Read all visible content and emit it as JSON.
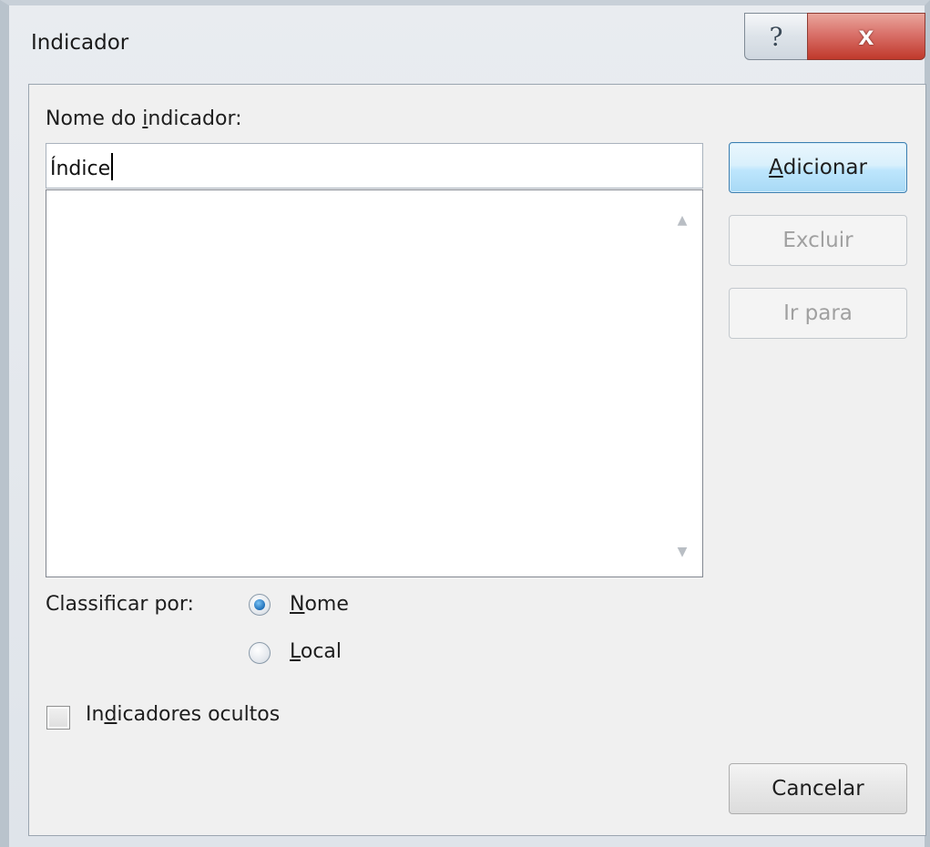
{
  "window": {
    "title": "Indicador",
    "help_glyph": "?",
    "close_glyph": "x"
  },
  "name_field": {
    "label_pre": "Nome do ",
    "label_accel": "i",
    "label_post": "ndicador:",
    "value": "Índice"
  },
  "buttons": {
    "add_accel": "A",
    "add_rest": "dicionar",
    "delete": "Excluir",
    "go_to": "Ir para",
    "cancel": "Cancelar"
  },
  "sort": {
    "label": "Classificar por:",
    "options": [
      {
        "accel": "N",
        "rest": "ome",
        "selected": true
      },
      {
        "accel": "L",
        "rest": "ocal",
        "selected": false
      }
    ]
  },
  "hidden": {
    "label_pre": "In",
    "label_accel": "d",
    "label_post": "icadores ocultos",
    "checked": false
  },
  "icons": {
    "help": "help-icon",
    "close": "close-icon",
    "scroll_up": "scroll-up-arrow-icon",
    "scroll_down": "scroll-down-arrow-icon"
  },
  "colors": {
    "primary_button": "#bee6fd",
    "close_button": "#c0392b",
    "radio_selected": "#1f6fb8"
  }
}
